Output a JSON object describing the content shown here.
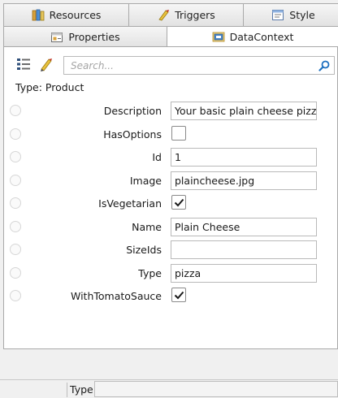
{
  "tabs_top": [
    {
      "label": "Resources",
      "icon": "resources-icon"
    },
    {
      "label": "Triggers",
      "icon": "triggers-icon"
    },
    {
      "label": "Style",
      "icon": "style-icon"
    }
  ],
  "tabs_bottom": [
    {
      "label": "Properties",
      "icon": "properties-icon"
    },
    {
      "label": "DataContext",
      "icon": "datacontext-icon",
      "active": true
    }
  ],
  "search": {
    "placeholder": "Search...",
    "value": ""
  },
  "type_line": "Type: Product",
  "properties": [
    {
      "name": "Description",
      "kind": "text",
      "value": "Your basic plain cheese pizza w"
    },
    {
      "name": "HasOptions",
      "kind": "bool",
      "checked": false
    },
    {
      "name": "Id",
      "kind": "text",
      "value": "1"
    },
    {
      "name": "Image",
      "kind": "text",
      "value": "plaincheese.jpg"
    },
    {
      "name": "IsVegetarian",
      "kind": "bool",
      "checked": true
    },
    {
      "name": "Name",
      "kind": "text",
      "value": "Plain Cheese"
    },
    {
      "name": "SizeIds",
      "kind": "text",
      "value": ""
    },
    {
      "name": "Type",
      "kind": "text",
      "value": "pizza"
    },
    {
      "name": "WithTomatoSauce",
      "kind": "bool",
      "checked": true
    }
  ],
  "status": {
    "label": "Type"
  },
  "colors": {
    "accent": "#1c6fbf",
    "border": "#a9a9a9"
  }
}
